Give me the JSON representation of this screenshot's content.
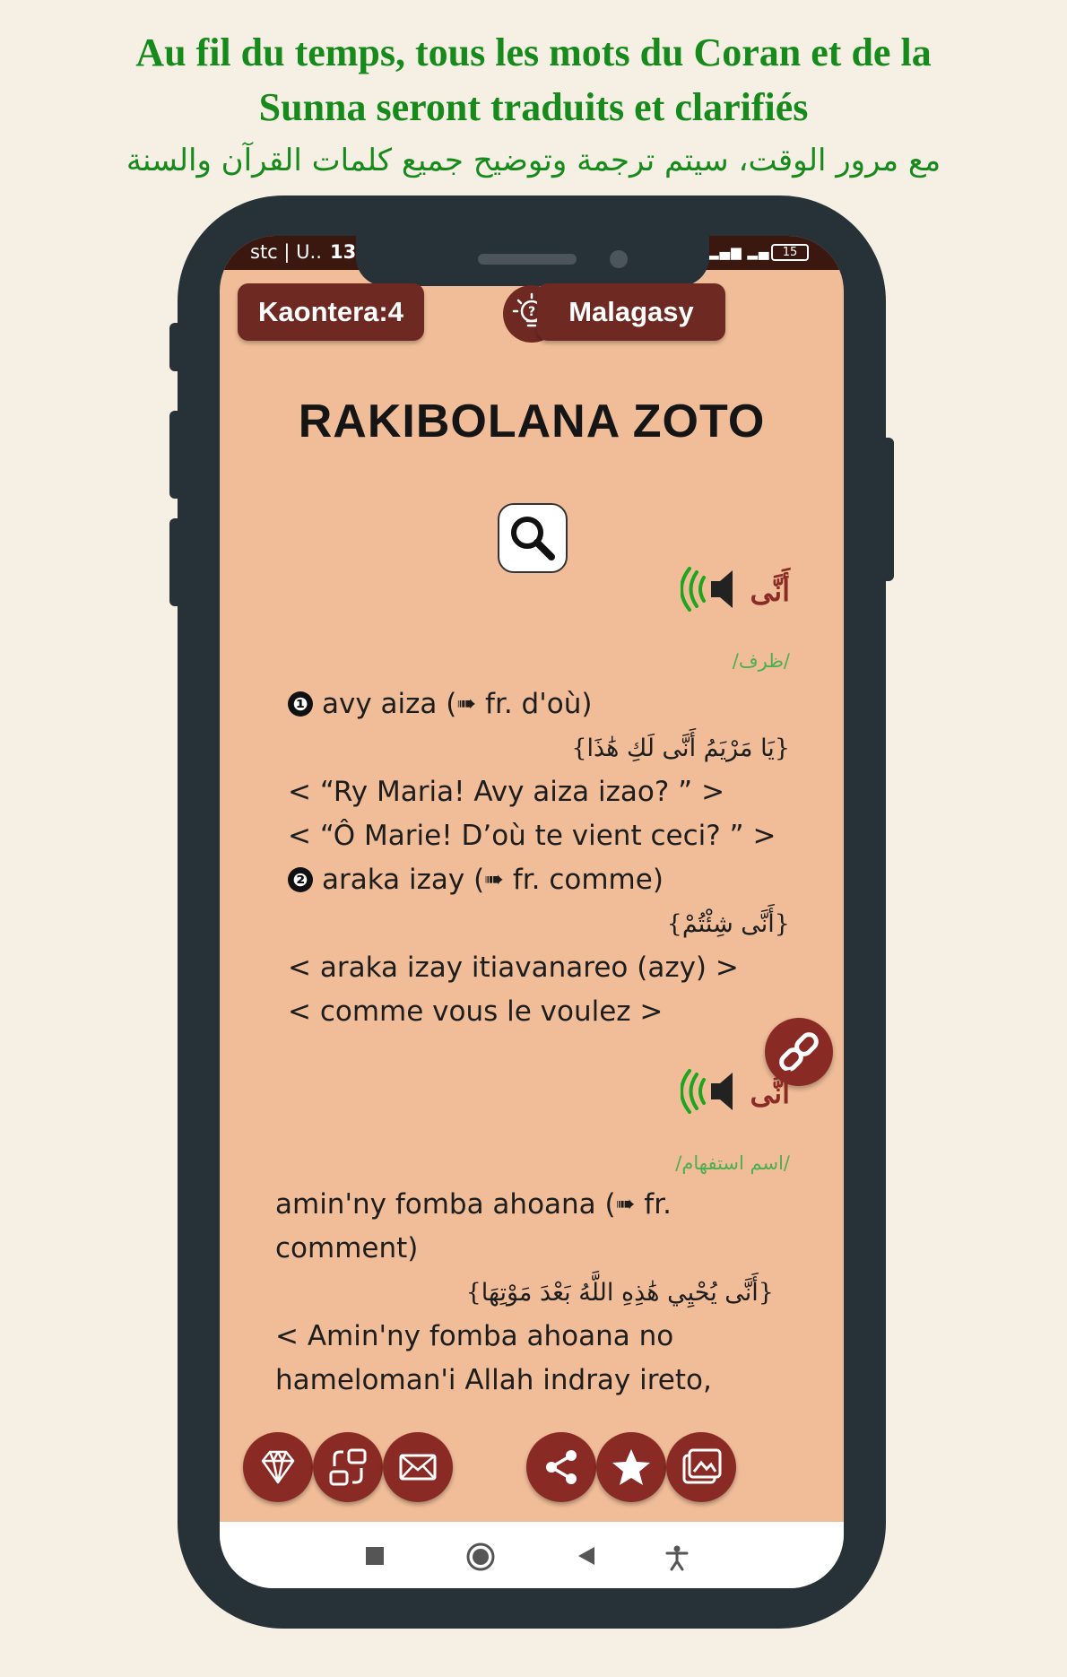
{
  "headline": {
    "fr_line1": "Au fil du temps, tous les mots du Coran et de la",
    "fr_line2": "Sunna seront traduits et clarifiés",
    "ar": "مع مرور الوقت، سيتم ترجمة وتوضيح جميع كلمات القرآن والسنة"
  },
  "status_bar": {
    "carrier": "stc | U..",
    "time": "13",
    "battery": "15"
  },
  "header": {
    "counter_label": "Kaontera:4",
    "language_label": "Malagasy"
  },
  "page_title": "RAKIBOLANA ZOTO",
  "entries": [
    {
      "word": "أَنَّى",
      "type": "/ظرف/",
      "num1": "❶",
      "sense1": "avy aiza (",
      "sense1_arrow": "➠",
      "sense1_fr": " fr. d'où)",
      "example1_ar": "{يَا مَرْيَمُ أَنَّى لَكِ هَٰذَا}",
      "example1_mg": "< “Ry Maria! Avy aiza izao? ” >",
      "example1_fr": "< “Ô Marie! D’où te vient ceci? ” >",
      "num2": "❷",
      "sense2": "araka izay (",
      "sense2_arrow": "➠",
      "sense2_fr": " fr. comme)",
      "example2_ar": "{أَنَّى شِئْتُمْ}",
      "example2_mg": "< araka izay itiavanareo (azy) >",
      "example2_fr": "< comme vous le voulez >"
    },
    {
      "word": "أَنَّى",
      "type": "/اسم استفهام/",
      "sense1": "amin'ny fomba ahoana (",
      "sense1_arrow": "➠",
      "sense1_fr": " fr. comment)",
      "example1_ar": "{أَنَّى يُحْيِي هَٰذِهِ اللَّهُ بَعْدَ مَوْتِهَا}",
      "example1_mg": "< Amin'ny fomba ahoana no hameloman'i Allah indray ireto,"
    }
  ],
  "colors": {
    "background": "#f6f0e4",
    "headline_green": "#178a1c",
    "screen": "#f0bd98",
    "maroon": "#6e2a22",
    "phone_body": "#263238",
    "type_green": "#4caf50"
  },
  "icons": {
    "top": [
      "lightbulb-question-icon"
    ],
    "entry": [
      "speaker-icon"
    ],
    "floating": [
      "link-icon"
    ],
    "bottom_left": [
      "diamond-icon",
      "swap-icon",
      "mail-icon"
    ],
    "bottom_right": [
      "share-icon",
      "star-icon",
      "gallery-icon"
    ],
    "nav": [
      "recents-icon",
      "home-icon",
      "back-icon",
      "accessibility-icon"
    ]
  }
}
